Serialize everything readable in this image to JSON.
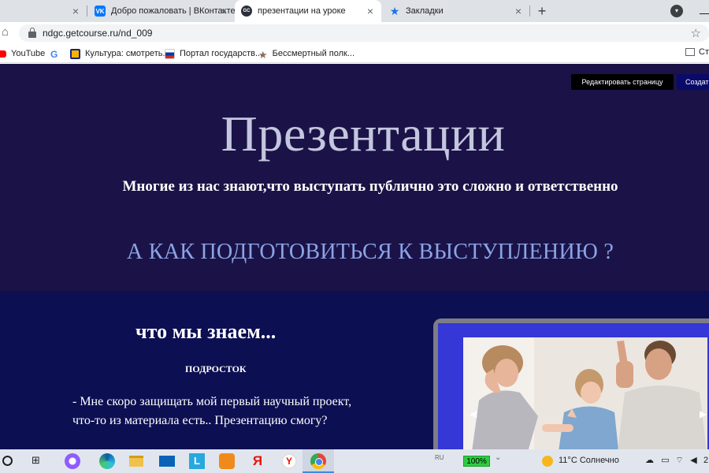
{
  "browser": {
    "tabs": [
      {
        "title": "",
        "favicon": "",
        "active": false
      },
      {
        "title": "Добро пожаловать | ВКонтакте",
        "favicon": "vk-icon",
        "active": false
      },
      {
        "title": "презентации на уроке",
        "favicon": "gc-icon",
        "active": true
      },
      {
        "title": "Закладки",
        "favicon": "star-icon",
        "active": false
      }
    ],
    "close_glyph": "×",
    "new_tab_glyph": "+",
    "address": "ndgc.getcourse.ru/nd_009",
    "bookmarks": [
      {
        "label": "YouTube",
        "icon": "youtube-icon"
      },
      {
        "label": "",
        "icon": "google-icon"
      },
      {
        "label": "Культура: смотреть...",
        "icon": "kultura-icon"
      },
      {
        "label": "Портал государств...",
        "icon": "gosuslugi-icon"
      },
      {
        "label": "Бессмертный полк...",
        "icon": "bessmertny-polk-icon"
      }
    ],
    "other_bookmarks": "Ст"
  },
  "page": {
    "edit_button": "Редактировать страницу",
    "create_button": "Создат",
    "hero": {
      "title": "Презентации",
      "subtitle": "Многие из нас знают,что выступать публично это сложно и ответственно",
      "question": "А  КАК ПОДГОТОВИТЬСЯ К ВЫСТУПЛЕНИЮ ?"
    },
    "section": {
      "title": "что мы знаем...",
      "label": "ПОДРОСТОК",
      "text": "- Мне скоро защищать  мой первый  научный проект, что-то из материала есть.. Презентацию смогу?"
    },
    "slider": {
      "left_arrow": "◀",
      "right_arrow": "▶"
    }
  },
  "taskbar": {
    "language": "RU",
    "zoom": "100%",
    "weather": "11°C  Солнечно",
    "clock": "2"
  },
  "colors": {
    "hero_bg": "#1b1347",
    "section_bg": "#0c0f52",
    "title": "#c3c6de",
    "question": "#8ba4e6",
    "slider_bg": "#3537d6"
  }
}
